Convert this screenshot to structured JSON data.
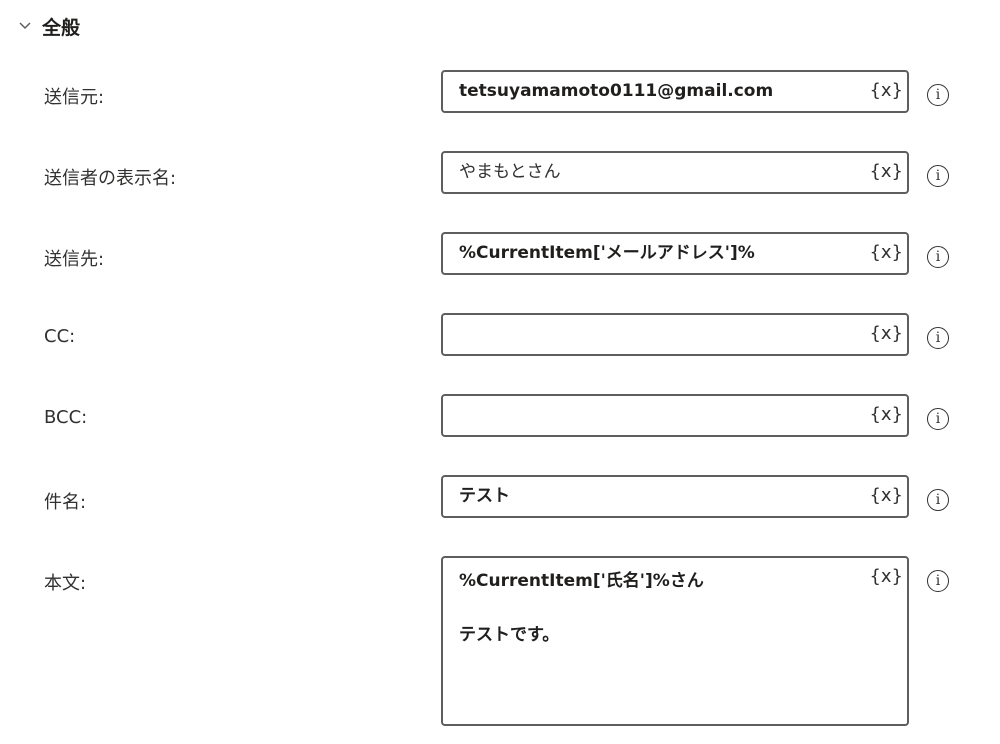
{
  "section": {
    "title": "全般",
    "expand_icon": "chevron-down-icon"
  },
  "fields": {
    "from": {
      "label": "送信元:",
      "value": "tetsuyamamoto0111@gmail.com"
    },
    "display_name": {
      "label": "送信者の表示名:",
      "value": "やまもとさん"
    },
    "to": {
      "label": "送信先:",
      "value": "%CurrentItem['メールアドレス']%"
    },
    "cc": {
      "label": "CC:",
      "value": ""
    },
    "bcc": {
      "label": "BCC:",
      "value": ""
    },
    "subject": {
      "label": "件名:",
      "value": "テスト"
    },
    "body": {
      "label": "本文:",
      "line1": "%CurrentItem['氏名']%さん",
      "line2": "テストです。"
    }
  },
  "variable_button": "{x}",
  "info_glyph": "i",
  "icons": {
    "variable": "variable-braces-icon",
    "info": "info-circle-icon"
  }
}
